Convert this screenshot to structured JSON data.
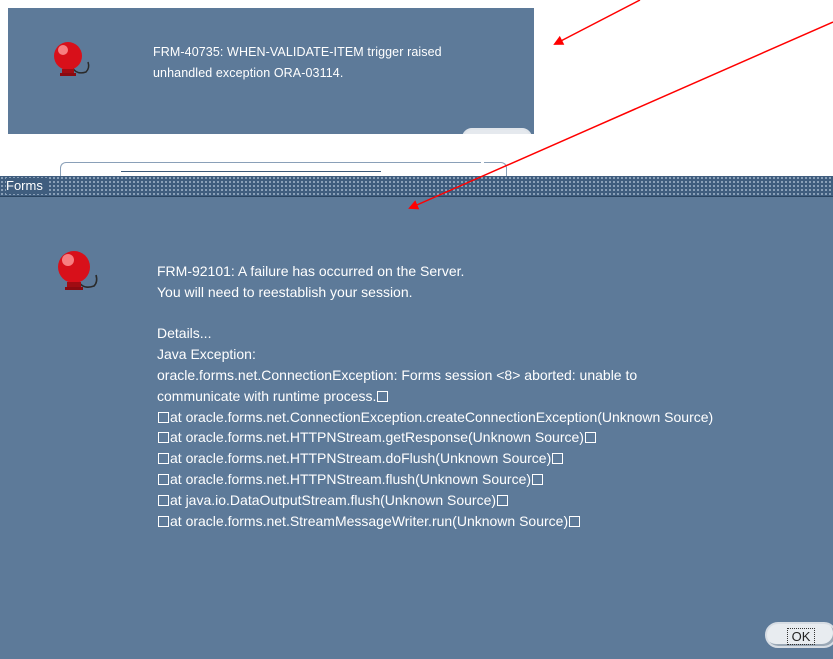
{
  "top_dialog": {
    "message_lines": [
      "FRM-40735: WHEN-VALIDATE-ITEM trigger raised",
      "unhandled exception ORA-03114."
    ]
  },
  "main_dialog": {
    "title": "Forms",
    "message_lines": [
      "FRM-92101: A failure has occurred on the Server.",
      "You will need to reestablish your session.",
      "",
      "Details...",
      "Java Exception:",
      "oracle.forms.net.ConnectionException: Forms session <8> aborted: unable to",
      "communicate with runtime process.",
      "at oracle.forms.net.ConnectionException.createConnectionException(Unknown Source)",
      "at oracle.forms.net.HTTPNStream.getResponse(Unknown Source)",
      "at oracle.forms.net.HTTPNStream.doFlush(Unknown Source)",
      "at oracle.forms.net.HTTPNStream.flush(Unknown Source)",
      "at java.io.DataOutputStream.flush(Unknown Source)",
      "at oracle.forms.net.StreamMessageWriter.run(Unknown Source)"
    ],
    "ok_label": "OK"
  },
  "icons": {
    "alarm": "alarm-bell-icon"
  },
  "colors": {
    "dialog_bg": "#5d7a99",
    "titlebar_bg": "#3f5d7e",
    "arrow": "#ff0000",
    "bell": "#e0141e"
  }
}
